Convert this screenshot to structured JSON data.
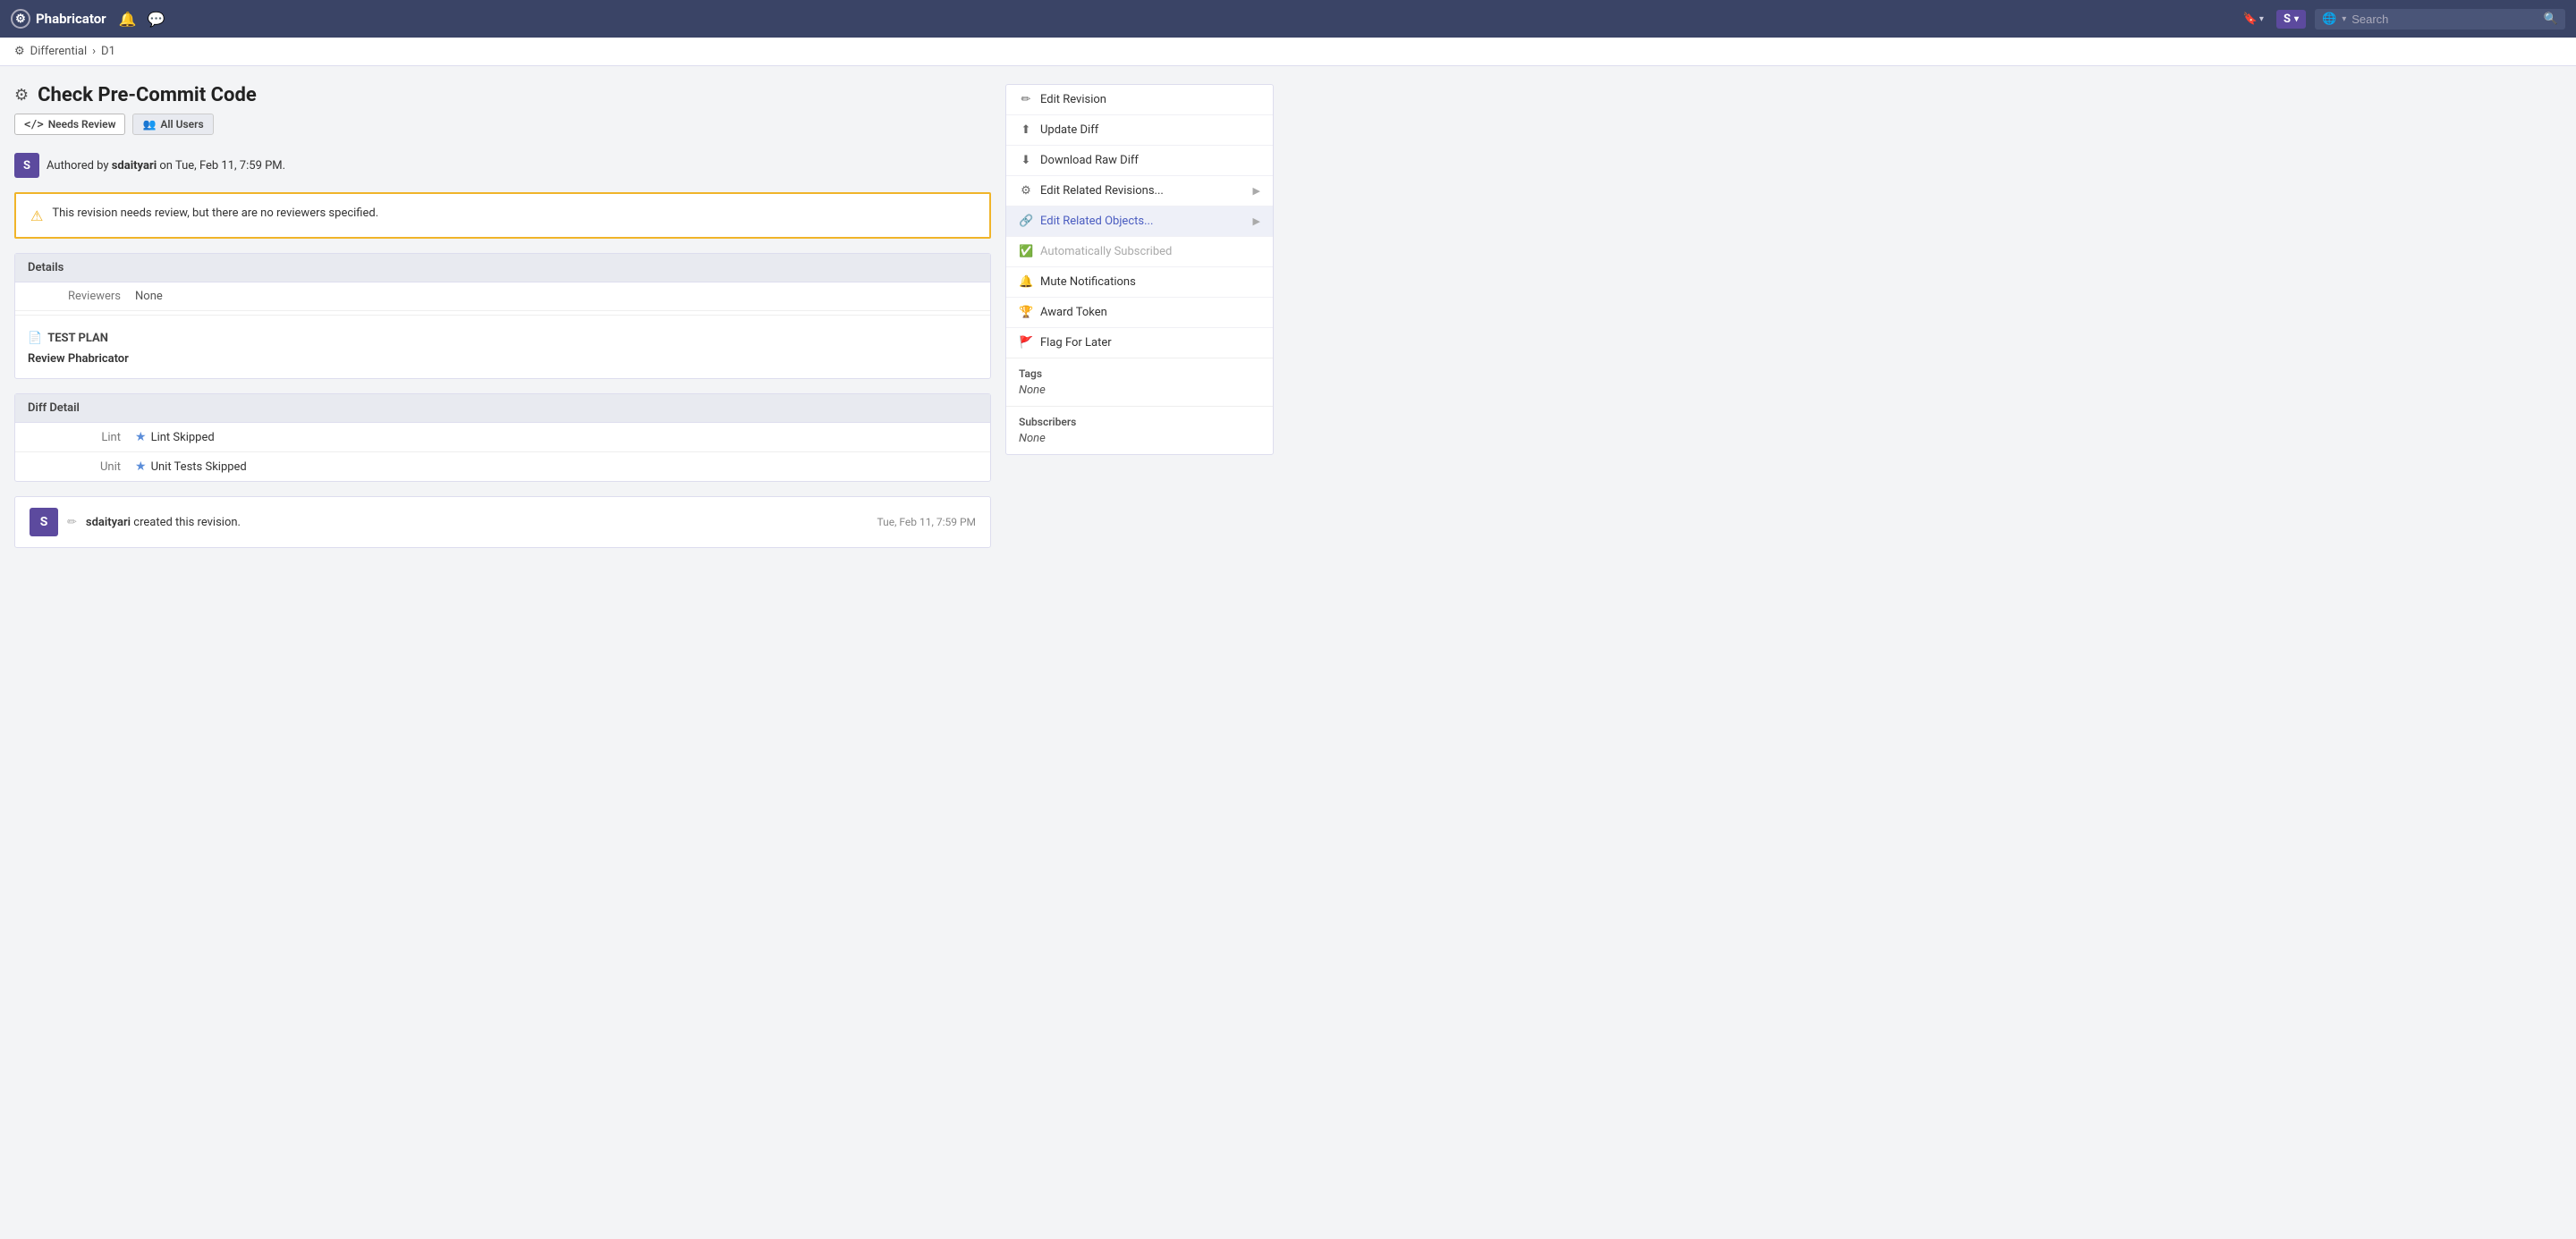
{
  "app": {
    "name": "Phabricator"
  },
  "topnav": {
    "logo": "⚙",
    "bell_icon": "🔔",
    "chat_icon": "💬",
    "bookmark_label": "🔖",
    "user_initial": "S",
    "search_placeholder": "Search",
    "globe_icon": "🌐"
  },
  "breadcrumb": {
    "parent": "Differential",
    "separator": "›",
    "current": "D1"
  },
  "page": {
    "title": "Check Pre-Commit Code",
    "status_badge": "Needs Review",
    "audience_badge": "All Users"
  },
  "author": {
    "initial": "S",
    "text_prefix": "Authored by",
    "username": "sdaityari",
    "text_suffix": "on Tue, Feb 11, 7:59 PM."
  },
  "warning": {
    "text": "This revision needs review, but there are no reviewers specified."
  },
  "details": {
    "header": "Details",
    "reviewers_label": "Reviewers",
    "reviewers_value": "None",
    "test_plan_header": "TEST PLAN",
    "test_plan_content": "Review Phabricator"
  },
  "diff_detail": {
    "header": "Diff Detail",
    "lint_label": "Lint",
    "lint_value": "Lint Skipped",
    "unit_label": "Unit",
    "unit_value": "Unit Tests Skipped"
  },
  "activity": {
    "user_initial": "S",
    "pencil": "✏",
    "username": "sdaityari",
    "action": "created this revision.",
    "timestamp": "Tue, Feb 11, 7:59 PM"
  },
  "sidebar": {
    "menu_items": [
      {
        "id": "edit-revision",
        "icon": "✏",
        "label": "Edit Revision",
        "has_arrow": false,
        "disabled": false,
        "active": false
      },
      {
        "id": "update-diff",
        "icon": "⬆",
        "label": "Update Diff",
        "has_arrow": false,
        "disabled": false,
        "active": false
      },
      {
        "id": "download-raw-diff",
        "icon": "⬇",
        "label": "Download Raw Diff",
        "has_arrow": false,
        "disabled": false,
        "active": false
      },
      {
        "id": "edit-related-revisions",
        "icon": "⚙",
        "label": "Edit Related Revisions...",
        "has_arrow": true,
        "disabled": false,
        "active": false
      },
      {
        "id": "edit-related-objects",
        "icon": "🔗",
        "label": "Edit Related Objects...",
        "has_arrow": true,
        "disabled": false,
        "active": true
      },
      {
        "id": "auto-subscribed",
        "icon": "✅",
        "label": "Automatically Subscribed",
        "has_arrow": false,
        "disabled": true,
        "active": false
      },
      {
        "id": "mute-notifications",
        "icon": "🔔",
        "label": "Mute Notifications",
        "has_arrow": false,
        "disabled": false,
        "active": false
      },
      {
        "id": "award-token",
        "icon": "🏆",
        "label": "Award Token",
        "has_arrow": false,
        "disabled": false,
        "active": false
      },
      {
        "id": "flag-for-later",
        "icon": "🚩",
        "label": "Flag For Later",
        "has_arrow": false,
        "disabled": false,
        "active": false
      }
    ],
    "tags_label": "Tags",
    "tags_value": "None",
    "subscribers_label": "Subscribers",
    "subscribers_value": "None"
  }
}
